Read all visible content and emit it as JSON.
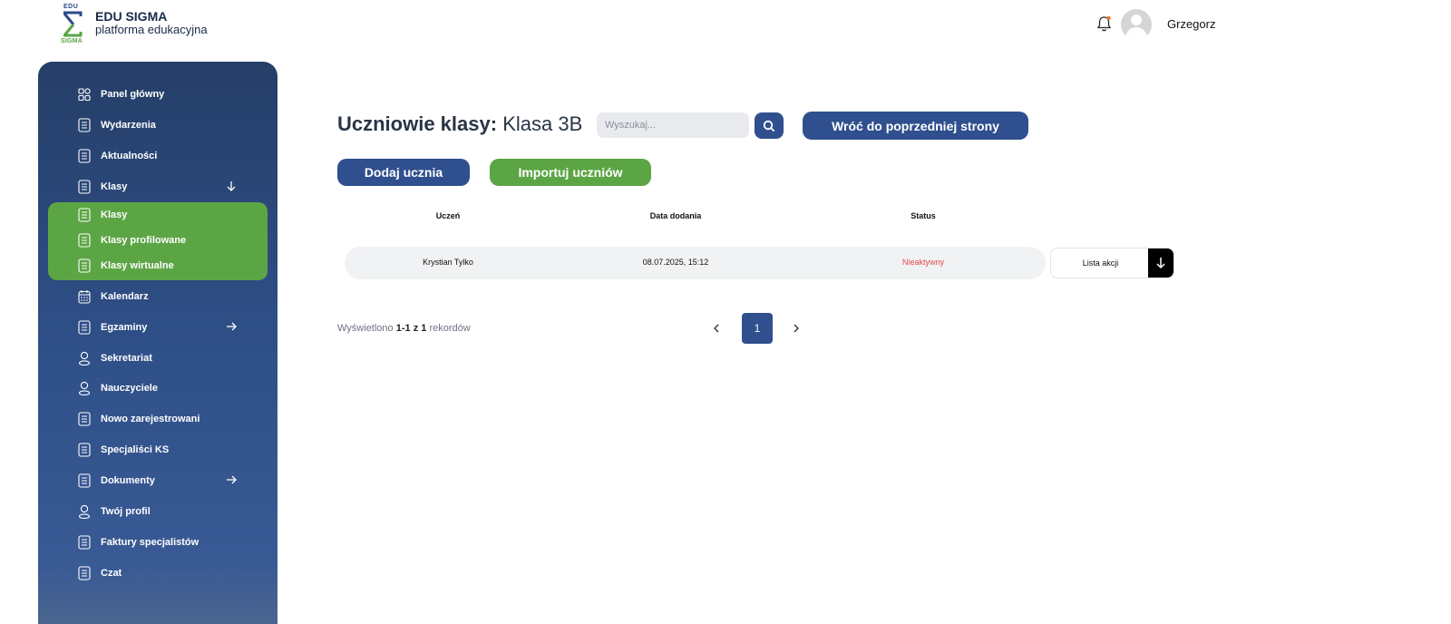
{
  "header": {
    "logo_top": "EDU",
    "logo_bottom": "SIGMA",
    "brand_title": "EDU SIGMA",
    "brand_subtitle": "platforma edukacyjna",
    "username": "Grzegorz"
  },
  "sidebar": {
    "items": [
      {
        "label": "Panel główny",
        "icon": "grid-icon"
      },
      {
        "label": "Wydarzenia",
        "icon": "document-icon"
      },
      {
        "label": "Aktualności",
        "icon": "document-icon"
      },
      {
        "label": "Klasy",
        "icon": "document-icon",
        "arrow": "arrow-down-icon"
      },
      {
        "label": "Kalendarz",
        "icon": "calendar-icon"
      },
      {
        "label": "Egzaminy",
        "icon": "document-icon",
        "arrow": "arrow-right-icon"
      },
      {
        "label": "Sekretariat",
        "icon": "user-icon"
      },
      {
        "label": "Nauczyciele",
        "icon": "user-icon"
      },
      {
        "label": "Nowo zarejestrowani",
        "icon": "document-icon"
      },
      {
        "label": "Specjaliści KS",
        "icon": "document-icon"
      },
      {
        "label": "Dokumenty",
        "icon": "document-icon",
        "arrow": "arrow-right-icon"
      },
      {
        "label": "Twój profil",
        "icon": "user-icon"
      },
      {
        "label": "Faktury specjalistów",
        "icon": "document-icon"
      },
      {
        "label": "Czat",
        "icon": "document-icon"
      }
    ],
    "submenu": [
      {
        "label": "Klasy"
      },
      {
        "label": "Klasy profilowane"
      },
      {
        "label": "Klasy wirtualne"
      }
    ]
  },
  "main": {
    "title_bold": "Uczniowie klasy:",
    "title_class": "Klasa 3B",
    "search_placeholder": "Wyszukaj...",
    "back_button": "Wróć do poprzedniej strony",
    "add_button": "Dodaj ucznia",
    "import_button": "Importuj uczniów",
    "table": {
      "headers": [
        "Uczeń",
        "Data dodania",
        "Status"
      ],
      "rows": [
        {
          "student": "Krystian Tylko",
          "date": "08.07.2025, 15:12",
          "status": "Nieaktywny",
          "action_label": "Lista akcji"
        }
      ]
    },
    "records_prefix": "Wyświetlono",
    "records_range": "1-1",
    "records_of": "z",
    "records_total": "1",
    "records_suffix": "rekordów",
    "current_page": "1"
  },
  "colors": {
    "primary": "#2f4f8e",
    "accent_green": "#5ca545",
    "status_inactive": "#e04b4b"
  }
}
